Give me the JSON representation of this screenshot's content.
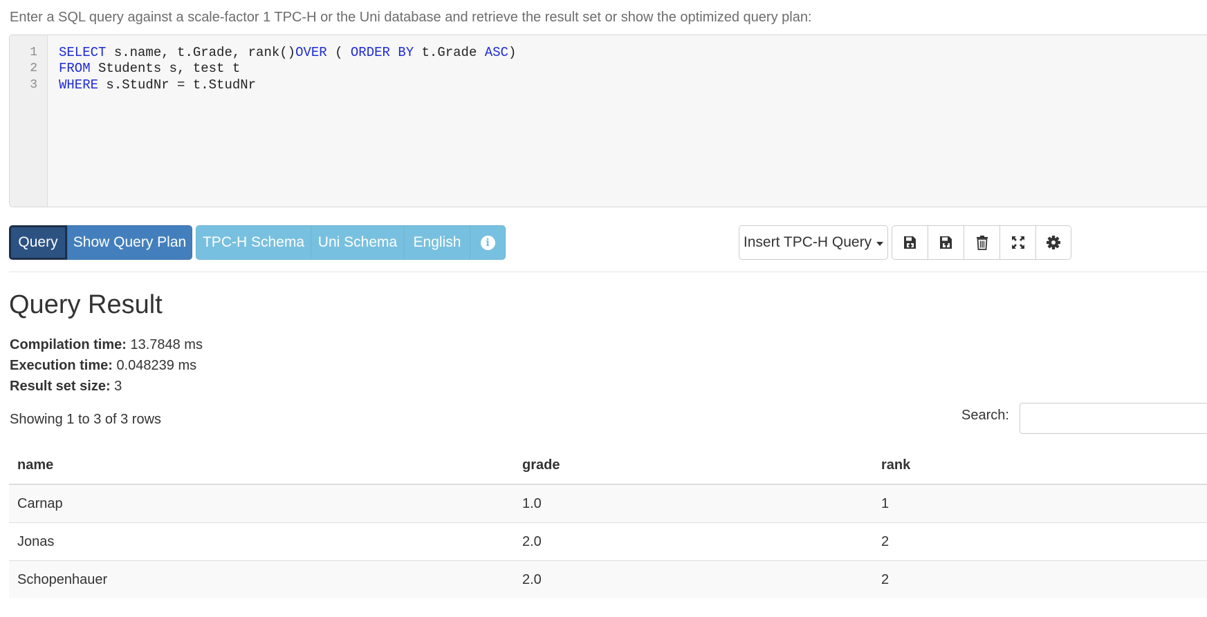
{
  "intro": "Enter a SQL query against a scale-factor 1 TPC-H or the Uni database and retrieve the result set or show the optimized query plan:",
  "editor": {
    "line_numbers": [
      "1",
      "2",
      "3"
    ],
    "lines": [
      [
        {
          "t": "SELECT",
          "kw": true
        },
        {
          "t": " s.name, t.Grade, rank()",
          "kw": false
        },
        {
          "t": "OVER",
          "kw": true
        },
        {
          "t": " ( ",
          "kw": false
        },
        {
          "t": "ORDER BY",
          "kw": true
        },
        {
          "t": " t.Grade ",
          "kw": false
        },
        {
          "t": "ASC",
          "kw": true
        },
        {
          "t": ")",
          "kw": false
        }
      ],
      [
        {
          "t": "FROM",
          "kw": true
        },
        {
          "t": " Students s, test t",
          "kw": false
        }
      ],
      [
        {
          "t": "WHERE",
          "kw": true
        },
        {
          "t": " s.StudNr = t.StudNr",
          "kw": false
        }
      ]
    ]
  },
  "toolbar": {
    "query": "Query",
    "show_plan": "Show Query Plan",
    "tpch_schema": "TPC-H Schema",
    "uni_schema": "Uni Schema",
    "language": "English",
    "info_glyph": "i",
    "insert_query": "Insert TPC-H Query",
    "icons": [
      "save-down-icon",
      "save-up-icon",
      "trash-icon",
      "fullscreen-icon",
      "gear-icon"
    ]
  },
  "result": {
    "heading": "Query Result",
    "compilation_label": "Compilation time:",
    "compilation_value": "13.7848 ms",
    "execution_label": "Execution time:",
    "execution_value": "0.048239 ms",
    "size_label": "Result set size:",
    "size_value": "3",
    "showing": "Showing 1 to 3 of 3 rows",
    "search_label": "Search:",
    "search_value": "",
    "columns": [
      "name",
      "grade",
      "rank"
    ],
    "rows": [
      [
        "Carnap",
        "1.0",
        "1"
      ],
      [
        "Jonas",
        "2.0",
        "2"
      ],
      [
        "Schopenhauer",
        "2.0",
        "2"
      ]
    ]
  },
  "colors": {
    "primary": "#447fbd",
    "primary_active": "#2c5282",
    "info": "#78c0df",
    "keyword": "#1e2bd6"
  }
}
